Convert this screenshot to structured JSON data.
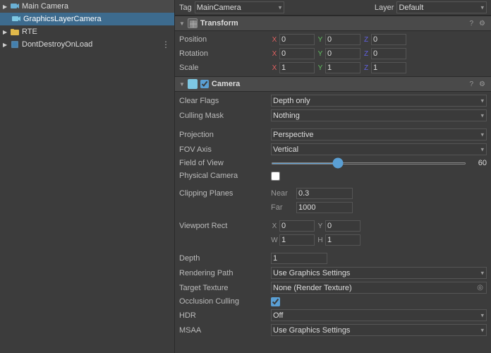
{
  "topbar": {
    "tag_label": "Tag",
    "tag_value": "MainCamera",
    "layer_label": "Layer",
    "layer_value": "Default"
  },
  "hierarchy": {
    "items": [
      {
        "id": "main-camera",
        "label": "Main Camera",
        "indent": 0,
        "type": "camera",
        "arrow": "▶",
        "selected": false
      },
      {
        "id": "graphics-layer-camera",
        "label": "GraphicsLayerCamera",
        "indent": 1,
        "type": "camera-sub",
        "arrow": "",
        "selected": true
      },
      {
        "id": "rte",
        "label": "RTE",
        "indent": 0,
        "type": "folder",
        "arrow": "▶",
        "selected": false
      },
      {
        "id": "dont-destroy",
        "label": "DontDestroyOnLoad",
        "indent": 0,
        "type": "cube",
        "arrow": "▶",
        "selected": false,
        "threedot": true
      }
    ]
  },
  "transform": {
    "section_title": "Transform",
    "position_label": "Position",
    "rotation_label": "Rotation",
    "scale_label": "Scale",
    "pos": {
      "x": "0",
      "y": "0",
      "z": "0"
    },
    "rot": {
      "x": "0",
      "y": "0",
      "z": "0"
    },
    "scale": {
      "x": "1",
      "y": "1",
      "z": "1"
    }
  },
  "camera": {
    "section_title": "Camera",
    "clear_flags_label": "Clear Flags",
    "clear_flags_value": "Depth only",
    "culling_mask_label": "Culling Mask",
    "culling_mask_value": "Nothing",
    "projection_label": "Projection",
    "projection_value": "Perspective",
    "fov_axis_label": "FOV Axis",
    "fov_axis_value": "Vertical",
    "field_of_view_label": "Field of View",
    "field_of_view_value": 60,
    "field_of_view_slider": 60,
    "physical_camera_label": "Physical Camera",
    "clipping_planes_label": "Clipping Planes",
    "near_label": "Near",
    "near_value": "0.3",
    "far_label": "Far",
    "far_value": "1000",
    "viewport_rect_label": "Viewport Rect",
    "vp_x": "0",
    "vp_y": "0",
    "vp_w": "1",
    "vp_h": "1",
    "depth_label": "Depth",
    "depth_value": "1",
    "rendering_path_label": "Rendering Path",
    "rendering_path_value": "Use Graphics Settings",
    "target_texture_label": "Target Texture",
    "target_texture_value": "None (Render Texture)",
    "occlusion_culling_label": "Occlusion Culling",
    "hdr_label": "HDR",
    "hdr_value": "Off",
    "msaa_label": "MSAA",
    "msaa_value": "Use Graphics Settings"
  }
}
